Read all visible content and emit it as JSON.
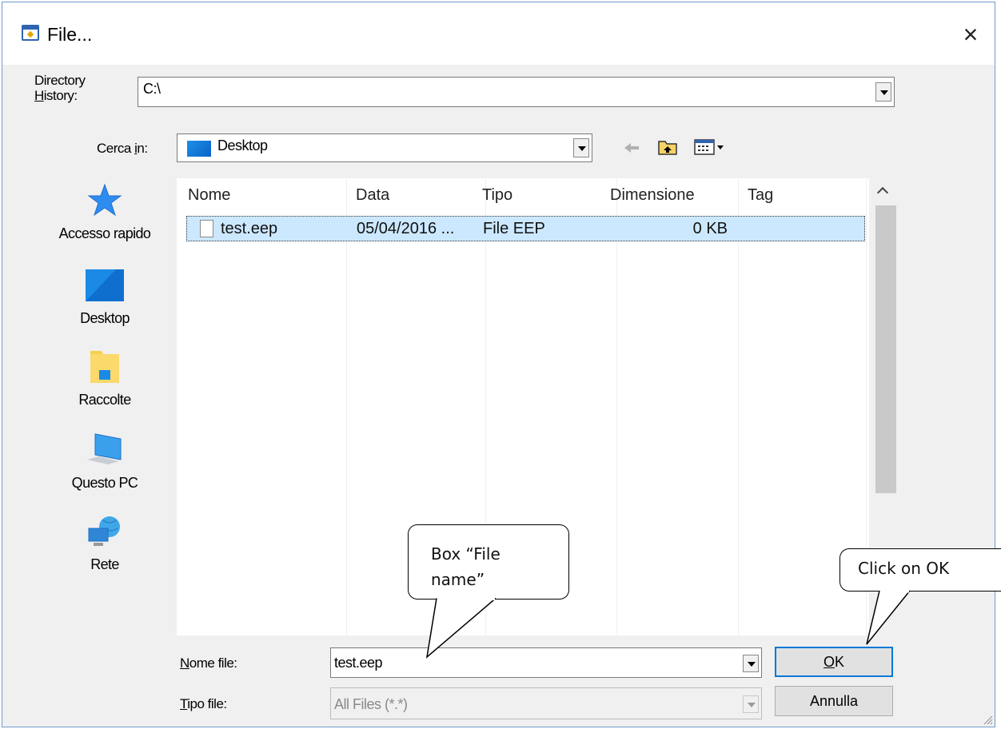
{
  "window": {
    "title": "File...",
    "close_glyph": "×"
  },
  "directory_history": {
    "label_line1": "Directory",
    "label_line2_accel": "H",
    "label_line2_rest": "istory:",
    "value": "C:\\"
  },
  "look_in": {
    "label_prefix": "Cerca ",
    "label_accel": "i",
    "label_suffix": "n:",
    "value": "Desktop",
    "toolbar_icons": [
      "back-arrow-icon",
      "up-folder-icon",
      "view-menu-icon"
    ]
  },
  "places": [
    {
      "label": "Accesso rapido",
      "icon": "star-icon"
    },
    {
      "label": "Desktop",
      "icon": "desktop-icon"
    },
    {
      "label": "Raccolte",
      "icon": "library-icon"
    },
    {
      "label": "Questo PC",
      "icon": "computer-icon"
    },
    {
      "label": "Rete",
      "icon": "network-icon"
    }
  ],
  "file_list": {
    "columns": [
      "Nome",
      "Data",
      "Tipo",
      "Dimensione",
      "Tag"
    ],
    "rows": [
      {
        "name": "test.eep",
        "date": "05/04/2016 ...",
        "type": "File EEP",
        "size": "0 KB",
        "tag": "",
        "selected": true
      }
    ]
  },
  "file_name": {
    "label_accel": "N",
    "label_rest": "ome file:",
    "value": "test.eep"
  },
  "file_type": {
    "label_accel": "T",
    "label_rest": "ipo file:",
    "value": "All Files (*.*)"
  },
  "buttons": {
    "ok_accel": "O",
    "ok_rest": "K",
    "cancel": "Annulla"
  },
  "annotations": {
    "file_name_callout_line1": "Box “File",
    "file_name_callout_line2": "name”",
    "ok_callout": "Click on OK"
  },
  "colors": {
    "selection": "#cce8ff",
    "default_button_border": "#0078d7",
    "window_border": "#6f9ac8"
  }
}
